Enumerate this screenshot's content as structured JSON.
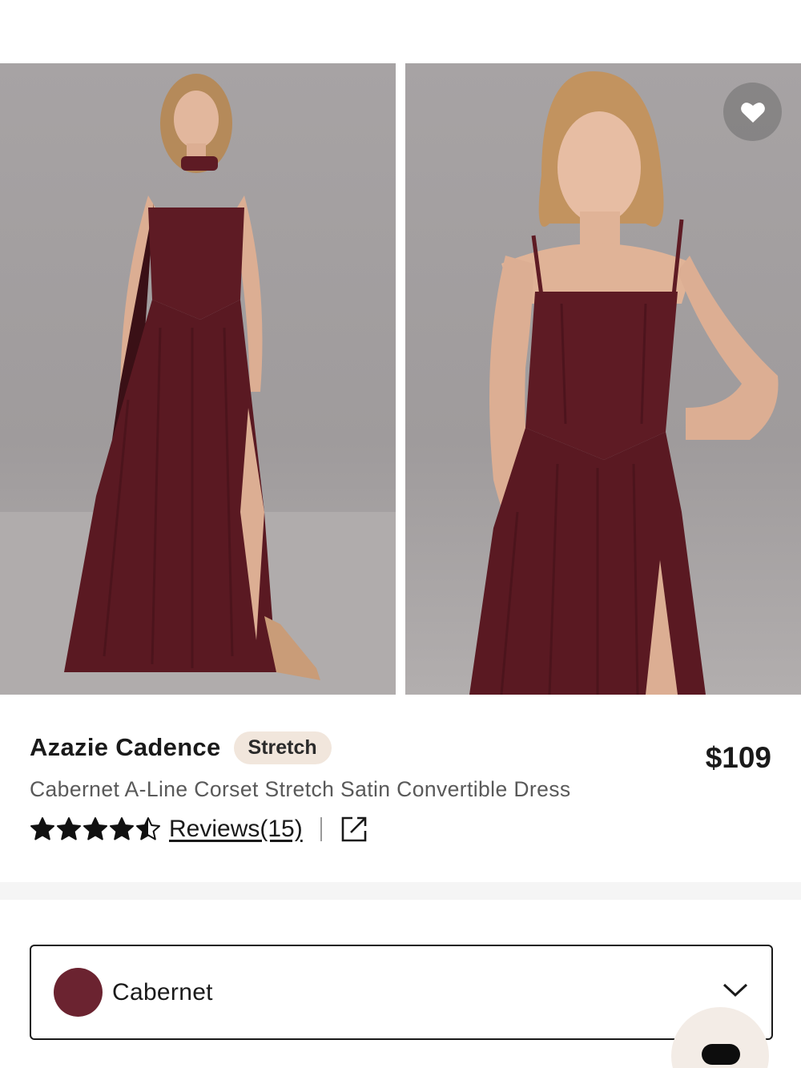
{
  "product": {
    "brand": "Azazie Cadence",
    "badge": "Stretch",
    "price": "$109",
    "description": "Cabernet A-Line Corset Stretch Satin Convertible Dress",
    "rating": 4.5,
    "rating_max": 5,
    "reviews_label": "Reviews(15)"
  },
  "gallery": {
    "images": [
      {
        "alt": "model-full-length-with-scarf"
      },
      {
        "alt": "model-close-up-spaghetti-straps"
      }
    ]
  },
  "color_selector": {
    "selected": "Cabernet",
    "swatch_color": "#6b2330"
  },
  "icons": {
    "favorite": "heart-icon",
    "share": "external-link-icon",
    "dropdown": "chevron-down-icon",
    "chat": "chat-icon"
  },
  "colors": {
    "dress": "#5e1b24",
    "backdrop": "#a5a1a2",
    "badge_bg": "#f1e6dc"
  }
}
